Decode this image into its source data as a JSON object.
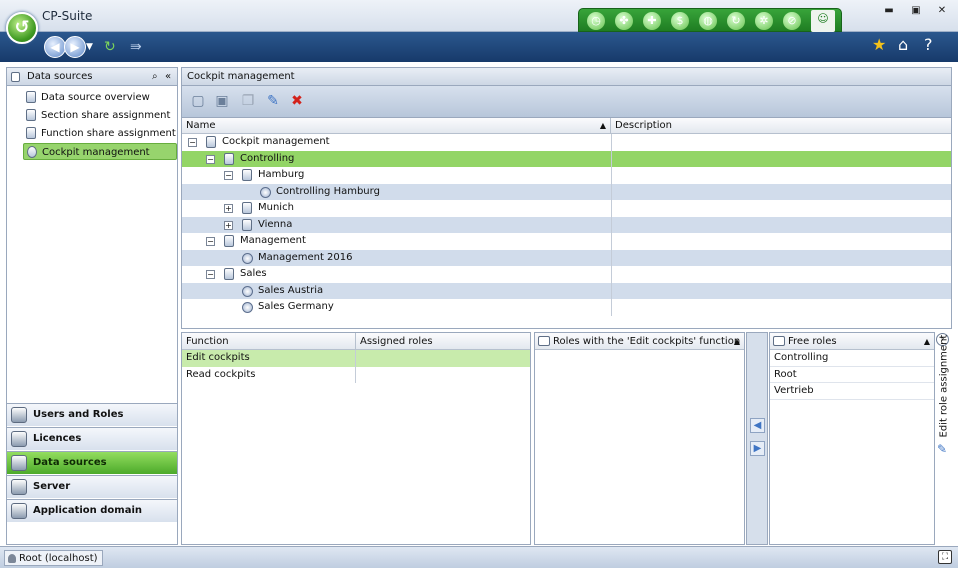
{
  "window": {
    "title": "CP-Suite"
  },
  "left_panel": {
    "title": "Data sources",
    "tree": [
      {
        "label": "Data source overview"
      },
      {
        "label": "Section share assignment"
      },
      {
        "label": "Function share assignment"
      },
      {
        "label": "Cockpit management"
      }
    ],
    "selected_index": 3
  },
  "nav_sections": [
    {
      "label": "Users and Roles"
    },
    {
      "label": "Licences"
    },
    {
      "label": "Data sources"
    },
    {
      "label": "Server"
    },
    {
      "label": "Application domain"
    }
  ],
  "active_nav_index": 2,
  "main": {
    "title": "Cockpit management",
    "columns": {
      "name": "Name",
      "description": "Description"
    },
    "rows": [
      {
        "label": "Cockpit management"
      },
      {
        "label": "Controlling"
      },
      {
        "label": "Hamburg"
      },
      {
        "label": "Controlling Hamburg"
      },
      {
        "label": "Munich"
      },
      {
        "label": "Vienna"
      },
      {
        "label": "Management"
      },
      {
        "label": "Management 2016"
      },
      {
        "label": "Sales"
      },
      {
        "label": "Sales Austria"
      },
      {
        "label": "Sales Germany"
      }
    ]
  },
  "functions": {
    "col_function": "Function",
    "col_roles": "Assigned roles",
    "rows": [
      {
        "name": "Edit cockpits",
        "roles": ""
      },
      {
        "name": "Read cockpits",
        "roles": ""
      }
    ]
  },
  "roles_with_function": {
    "title": "Roles with the 'Edit cockpits' function"
  },
  "free_roles": {
    "title": "Free roles",
    "items": [
      {
        "label": "Controlling"
      },
      {
        "label": "Root"
      },
      {
        "label": "Vertrieb"
      }
    ]
  },
  "side_tab": {
    "label": "Edit role assignment"
  },
  "status": {
    "text": "Root (localhost)"
  },
  "colors": {
    "accent_green": "#4caa2a",
    "selection_green": "#93d566",
    "toolbar_blue": "#173a6a",
    "alt_row": "#d1dceb"
  }
}
